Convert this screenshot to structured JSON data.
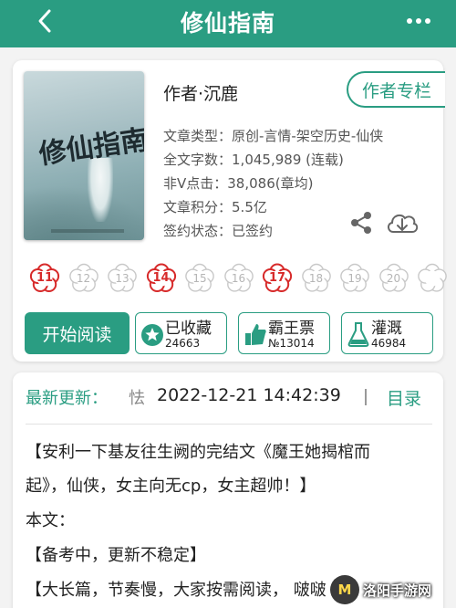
{
  "header": {
    "title": "修仙指南",
    "bg_color": "#2a9d82"
  },
  "book": {
    "cover_title": "修仙指南",
    "author": "作者·沉鹿",
    "author_column_label": "作者专栏",
    "meta": [
      {
        "key": "文章类型：",
        "value": "原创-言情-架空历史-仙侠"
      },
      {
        "key": "全文字数：",
        "value": "1,045,989 (连载)"
      },
      {
        "key": "非V点击：",
        "value": "38,086(章均)"
      },
      {
        "key": "文章积分：",
        "value": "5.5亿"
      },
      {
        "key": "签约状态：",
        "value": "已签约"
      }
    ]
  },
  "flowers": [
    {
      "label": "11",
      "active": true
    },
    {
      "label": "12",
      "active": false
    },
    {
      "label": "13",
      "active": false
    },
    {
      "label": "14",
      "active": true
    },
    {
      "label": "15",
      "active": false
    },
    {
      "label": "16",
      "active": false
    },
    {
      "label": "17",
      "active": true
    },
    {
      "label": "18",
      "active": false
    },
    {
      "label": "19",
      "active": false
    },
    {
      "label": "20",
      "active": false
    },
    {
      "label": "",
      "active": false
    }
  ],
  "actions": {
    "start_label": "开始阅读",
    "collect": {
      "label": "已收藏",
      "count": "24663",
      "icon": "star-icon"
    },
    "vote": {
      "label": "霸王票",
      "count": "№13014",
      "icon": "thumbs-up-icon"
    },
    "water": {
      "label": "灌溉",
      "count": "46984",
      "icon": "watering-flask-icon"
    }
  },
  "update": {
    "label": "最新更新：",
    "ghost": "怯",
    "time": "2022-12-21 14:42:39",
    "catalog": "目录"
  },
  "intro_lines": [
    "【安利一下基友往生阙的完结文《魔王她揭棺而",
    "起》，仙侠，女主向无cp，女主超帅！】",
    "本文：",
    "【备考中，更新不稳定】",
    "【大长篇，节奏慢，大家按需阅读，   啵啵"
  ],
  "watermark": {
    "badge": "M",
    "text": "洛阳手游网"
  }
}
